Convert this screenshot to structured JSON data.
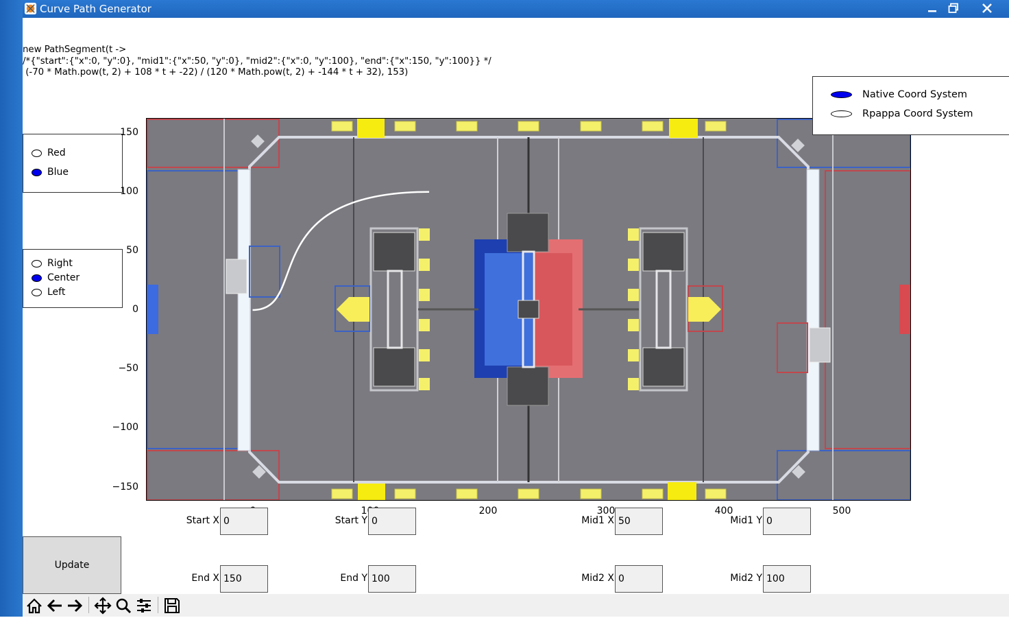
{
  "window": {
    "title": "Curve Path Generator",
    "minimize_icon": "minimize-icon",
    "maximize_icon": "restore-icon",
    "close_icon": "close-icon"
  },
  "code_output": {
    "line1": "new PathSegment(t ->",
    "line2": "/*{\"start\":{\"x\":0, \"y\":0}, \"mid1\":{\"x\":50, \"y\":0}, \"mid2\":{\"x\":0, \"y\":100}, \"end\":{\"x\":150, \"y\":100}} */",
    "line3": " (-70 * Math.pow(t, 2) + 108 * t + -22) / (120 * Math.pow(t, 2) + -144 * t + 32), 153)"
  },
  "alliance_radio": {
    "options": [
      "Red",
      "Blue"
    ],
    "selected": "Blue"
  },
  "position_radio": {
    "options": [
      "Right",
      "Center",
      "Left"
    ],
    "selected": "Center"
  },
  "coord_legend": {
    "items": [
      {
        "label": "Native Coord System",
        "color": "#0000ee"
      },
      {
        "label": "Rpappa Coord System",
        "color": "#ffffff"
      }
    ]
  },
  "plot": {
    "y_ticks": [
      "150",
      "100",
      "50",
      "0",
      "−50",
      "−100",
      "−150"
    ],
    "x_ticks": [
      "0",
      "100",
      "200",
      "300",
      "400",
      "500"
    ],
    "x_range": [
      -90,
      560
    ],
    "y_range": [
      -162,
      162
    ],
    "curve_color": "#ffffff",
    "field_image": "robotics-field-image"
  },
  "inputs": {
    "start_x": {
      "label": "Start X",
      "value": "0"
    },
    "start_y": {
      "label": "Start Y",
      "value": "0"
    },
    "mid1_x": {
      "label": "Mid1 X",
      "value": "50"
    },
    "mid1_y": {
      "label": "Mid1 Y",
      "value": "0"
    },
    "end_x": {
      "label": "End X",
      "value": "150"
    },
    "end_y": {
      "label": "End Y",
      "value": "100"
    },
    "mid2_x": {
      "label": "Mid2 X",
      "value": "0"
    },
    "mid2_y": {
      "label": "Mid2 Y",
      "value": "100"
    }
  },
  "update_button": {
    "label": "Update"
  },
  "toolbar": {
    "icons": [
      "home-icon",
      "back-icon",
      "forward-icon",
      "pan-icon",
      "zoom-icon",
      "configure-icon",
      "save-icon"
    ]
  }
}
